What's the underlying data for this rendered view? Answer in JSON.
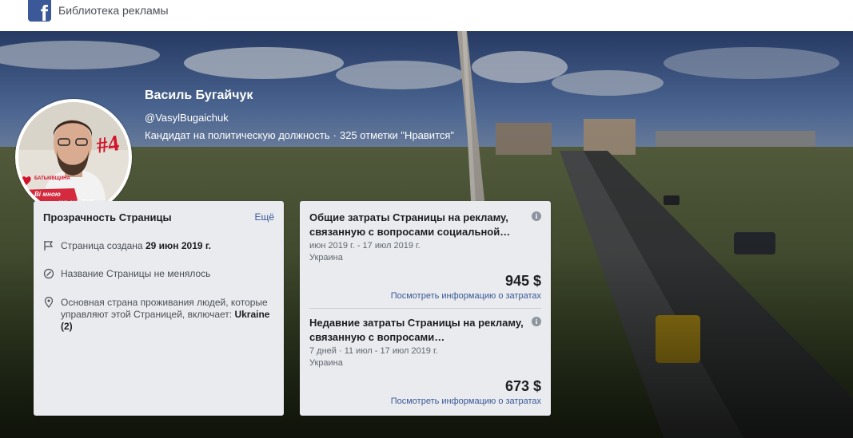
{
  "topbar": {
    "logo_letter": "f",
    "title": "Библиотека рекламы"
  },
  "page": {
    "name": "Василь Бугайчук",
    "handle": "@VasylBugaichuk",
    "category": "Кандидат на политическую должность",
    "separator": "·",
    "likes": "325 отметки \"Нравится\""
  },
  "avatar": {
    "number_badge": "#4",
    "party_label": "БАТЬКІВЩИНА",
    "slogan_line1": "Ві мною",
    "slogan_line2": "на на ТИ!"
  },
  "transparency": {
    "title": "Прозрачность Страницы",
    "more_label": "Ещё",
    "created_prefix": "Страница создана ",
    "created_date": "29 июн 2019 г.",
    "name_unchanged": "Название Страницы не менялось",
    "country_prefix": "Основная страна проживания людей, которые управляют этой Страницей, включает: ",
    "country_value": "Ukraine",
    "country_count": "(2)"
  },
  "spending": {
    "total": {
      "title": "Общие затраты Страницы на рекламу, связанную с вопросами социальной…",
      "dates": "июн 2019 г. - 17 июл 2019 г.",
      "country": "Украина",
      "amount": "945 $",
      "link": "Посмотреть информацию о затратах"
    },
    "recent": {
      "title": "Недавние затраты Страницы на рекламу, связанную с вопросами…",
      "dates": "7 дней · 11 июл - 17 июл 2019 г.",
      "country": "Украина",
      "amount": "673 $",
      "link": "Посмотреть информацию о затратах"
    },
    "info_glyph": "i"
  },
  "colors": {
    "facebook_blue": "#3b5998",
    "link": "#385898",
    "card_bg": "#e9ebee"
  }
}
